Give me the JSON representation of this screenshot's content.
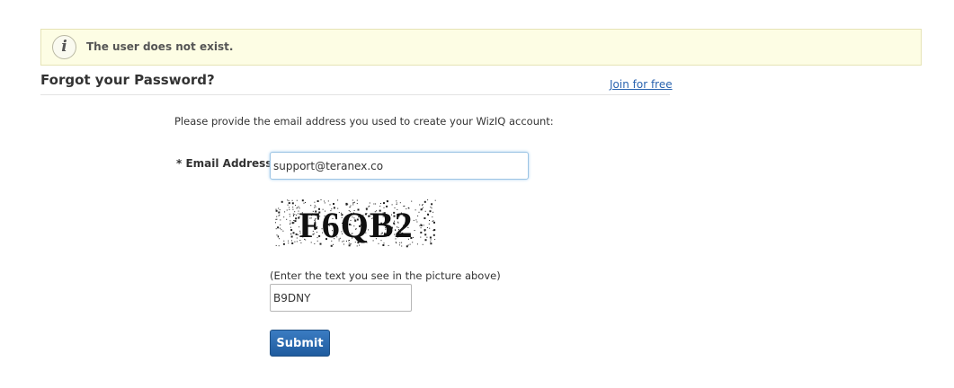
{
  "alert": {
    "icon": "info-icon",
    "icon_glyph": "i",
    "message": "The user does not exist."
  },
  "header": {
    "title": "Forgot your Password?",
    "join_link": "Join for free"
  },
  "form": {
    "instructions": "Please provide the email address you used to create your WizIQ account:",
    "email_label": "* Email Address:",
    "email_value": "support@teranex.co",
    "captcha_text": "F6QB2",
    "captcha_hint": "(Enter the text you see in the picture above)",
    "captcha_value": "B9DNY",
    "submit_label": "Submit"
  },
  "colors": {
    "alert_background": "#fdfde4",
    "link": "#2a64b0",
    "button": "#2a6aae"
  }
}
